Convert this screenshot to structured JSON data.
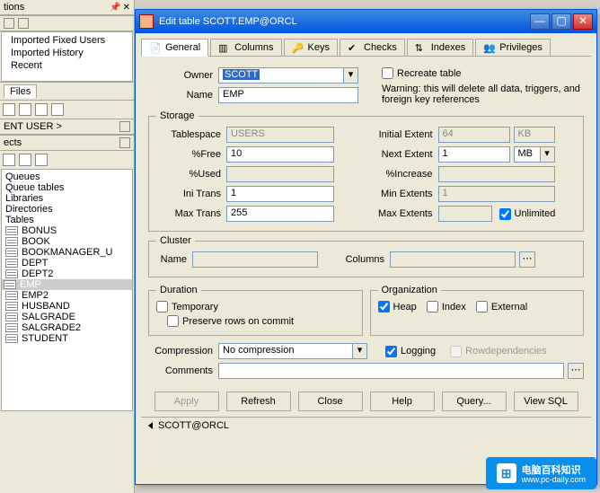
{
  "sidebar": {
    "top_label": "tions",
    "section1": {
      "items": [
        "Imported Fixed Users",
        "Imported History",
        "Recent"
      ]
    },
    "files_tab": "Files",
    "user_label": "ENT USER >",
    "ects_label": "ects",
    "tree_groups": [
      "Queues",
      "Queue tables",
      "Libraries",
      "Directories",
      "Tables"
    ],
    "tables": [
      "BONUS",
      "BOOK",
      "BOOKMANAGER_U",
      "DEPT",
      "DEPT2",
      "EMP",
      "EMP2",
      "HUSBAND",
      "SALGRADE",
      "SALGRADE2",
      "STUDENT"
    ]
  },
  "dialog": {
    "title": "Edit table SCOTT.EMP@ORCL",
    "tabs": {
      "general": "General",
      "columns": "Columns",
      "keys": "Keys",
      "checks": "Checks",
      "indexes": "Indexes",
      "privileges": "Privileges"
    },
    "owner_label": "Owner",
    "owner_value": "SCOTT",
    "name_label": "Name",
    "name_value": "EMP",
    "recreate_label": "Recreate table",
    "recreate_warning": "Warning: this will delete all data, triggers, and foreign key references",
    "storage": {
      "legend": "Storage",
      "tablespace_label": "Tablespace",
      "tablespace_value": "USERS",
      "pctfree_label": "%Free",
      "pctfree_value": "10",
      "pctused_label": "%Used",
      "pctused_value": "",
      "initrans_label": "Ini Trans",
      "initrans_value": "1",
      "maxtrans_label": "Max Trans",
      "maxtrans_value": "255",
      "initial_extent_label": "Initial Extent",
      "initial_extent_value": "64",
      "initial_extent_unit": "KB",
      "next_extent_label": "Next Extent",
      "next_extent_value": "1",
      "next_extent_unit": "MB",
      "pctincrease_label": "%Increase",
      "pctincrease_value": "",
      "min_extents_label": "Min Extents",
      "min_extents_value": "1",
      "max_extents_label": "Max Extents",
      "max_extents_value": "",
      "unlimited_label": "Unlimited"
    },
    "cluster": {
      "legend": "Cluster",
      "name_label": "Name",
      "columns_label": "Columns"
    },
    "duration": {
      "legend": "Duration",
      "temporary_label": "Temporary",
      "preserve_label": "Preserve rows on commit"
    },
    "organization": {
      "legend": "Organization",
      "heap_label": "Heap",
      "index_label": "Index",
      "external_label": "External"
    },
    "compression_label": "Compression",
    "compression_value": "No compression",
    "logging_label": "Logging",
    "rowdeps_label": "Rowdependencies",
    "comments_label": "Comments",
    "buttons": {
      "apply": "Apply",
      "refresh": "Refresh",
      "close": "Close",
      "help": "Help",
      "query": "Query...",
      "viewsql": "View SQL"
    },
    "status": "SCOTT@ORCL"
  },
  "watermark": {
    "main": "电脑百科知识",
    "sub": "www.pc-daily.com"
  }
}
